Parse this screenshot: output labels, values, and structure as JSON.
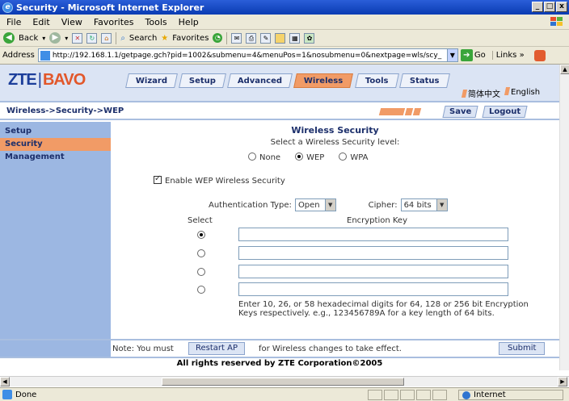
{
  "window": {
    "title": "Security - Microsoft Internet Explorer",
    "controls": [
      "_",
      "□",
      "x"
    ]
  },
  "menubar": [
    "File",
    "Edit",
    "View",
    "Favorites",
    "Tools",
    "Help"
  ],
  "toolbar": {
    "back": "Back",
    "search": "Search",
    "favorites": "Favorites"
  },
  "address": {
    "label": "Address",
    "url": "http://192.168.1.1/getpage.gch?pid=1002&submenu=4&menuPos=1&nosubmenu=0&nextpage=wls/scy_",
    "go": "Go",
    "links": "Links"
  },
  "router": {
    "logo_left": "ZTE",
    "logo_sep": "|",
    "logo_right": "BAVO",
    "tabs": [
      {
        "label": "Wizard"
      },
      {
        "label": "Setup"
      },
      {
        "label": "Advanced"
      },
      {
        "label": "Wireless",
        "active": true
      },
      {
        "label": "Tools"
      },
      {
        "label": "Status"
      }
    ],
    "lang": [
      "简体中文",
      "English"
    ],
    "breadcrumb": "Wireless->Security->WEP",
    "save": "Save",
    "logout": "Logout",
    "sidebar": [
      {
        "label": "Setup"
      },
      {
        "label": "Security",
        "active": true
      },
      {
        "label": "Management"
      }
    ]
  },
  "form": {
    "title": "Wireless Security",
    "subtitle": "Select a Wireless Security level:",
    "levels": [
      {
        "label": "None",
        "checked": false
      },
      {
        "label": "WEP",
        "checked": true
      },
      {
        "label": "WPA",
        "checked": false
      }
    ],
    "enable_label": "Enable WEP Wireless Security",
    "enable_checked": true,
    "auth_label": "Authentication Type:",
    "auth_value": "Open",
    "cipher_label": "Cipher:",
    "cipher_value": "64 bits",
    "select_header": "Select",
    "key_header": "Encryption Key",
    "keys": [
      {
        "selected": true,
        "value": ""
      },
      {
        "selected": false,
        "value": ""
      },
      {
        "selected": false,
        "value": ""
      },
      {
        "selected": false,
        "value": ""
      }
    ],
    "hint": "Enter 10, 26, or 58 hexadecimal digits for 64, 128 or 256 bit Encryption Keys respectively. e.g., 123456789A for a key length of 64 bits."
  },
  "footer": {
    "note_prefix": "Note: You must",
    "restart": "Restart AP",
    "note_suffix": "for Wireless changes to take effect.",
    "submit": "Submit",
    "copyright": "All rights reserved by ZTE Corporation©2005"
  },
  "status": {
    "text": "Done",
    "zone": "Internet"
  },
  "colors": {
    "accent_orange": "#f19b66",
    "nav_blue": "#9cb7e2",
    "banner_blue": "#dbe4f4",
    "title_blue": "#1c2f6b"
  }
}
